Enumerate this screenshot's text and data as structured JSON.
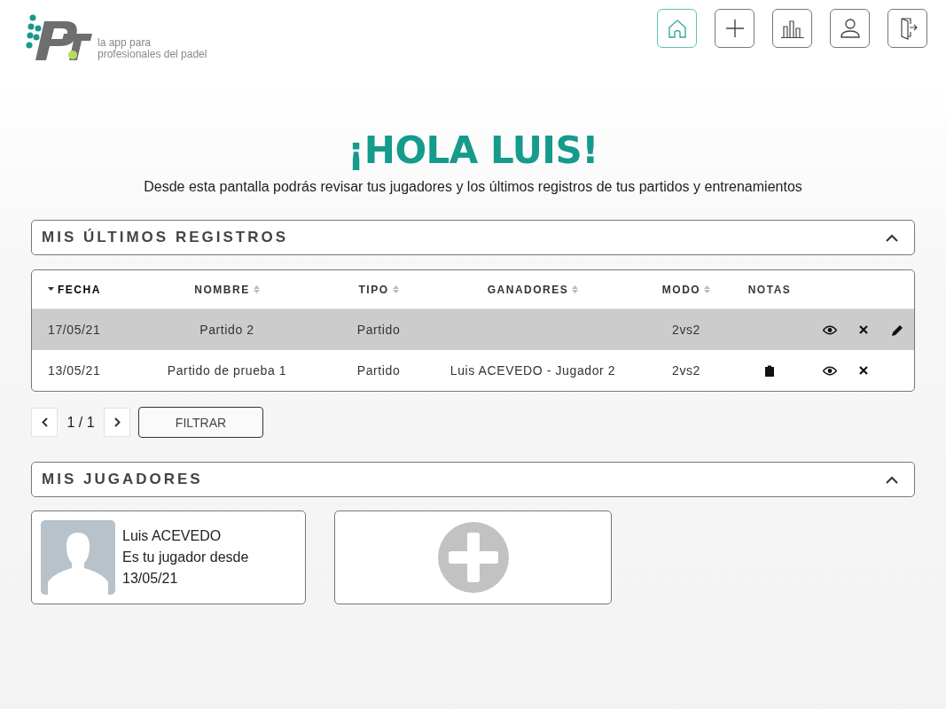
{
  "logo": {
    "tagline": [
      "la app para",
      "profesionales del padel"
    ]
  },
  "nav": [
    {
      "kind": "home",
      "selected": true
    },
    {
      "kind": "add",
      "selected": false
    },
    {
      "kind": "stats",
      "selected": false
    },
    {
      "kind": "profile",
      "selected": false
    },
    {
      "kind": "logout",
      "selected": false
    }
  ],
  "greeting": "¡HOLA LUIS!",
  "intro": "Desde esta pantalla podrás revisar tus jugadores y los últimos registros de tus partidos y entrenamientos",
  "records": {
    "title": "MIS ÚLTIMOS REGISTROS",
    "expanded": true,
    "columns": [
      {
        "label": "FECHA",
        "sortable": true,
        "sorted": true
      },
      {
        "label": "NOMBRE",
        "sortable": true,
        "sorted": false
      },
      {
        "label": "TIPO",
        "sortable": true,
        "sorted": false
      },
      {
        "label": "GANADORES",
        "sortable": true,
        "sorted": false
      },
      {
        "label": "MODO",
        "sortable": true,
        "sorted": false
      },
      {
        "label": "NOTAS",
        "sortable": false,
        "sorted": false
      }
    ],
    "rows": [
      {
        "cells": [
          "17/05/21",
          "Partido 2",
          "Partido",
          "",
          "2vs2"
        ],
        "has_notes": false,
        "editable": true,
        "selected": true
      },
      {
        "cells": [
          "13/05/21",
          "Partido de prueba 1",
          "Partido",
          "Luis ACEVEDO - Jugador 2",
          "2vs2"
        ],
        "has_notes": true,
        "editable": false,
        "selected": false
      }
    ],
    "page": "1 / 1",
    "filter_button": "FILTRAR"
  },
  "players": {
    "title": "MIS JUGADORES",
    "expanded": true,
    "cards": [
      {
        "kind": "player",
        "lines": [
          "Luis ACEVEDO",
          "Es tu jugador desde",
          "13/05/21"
        ]
      },
      {
        "kind": "add"
      }
    ]
  }
}
